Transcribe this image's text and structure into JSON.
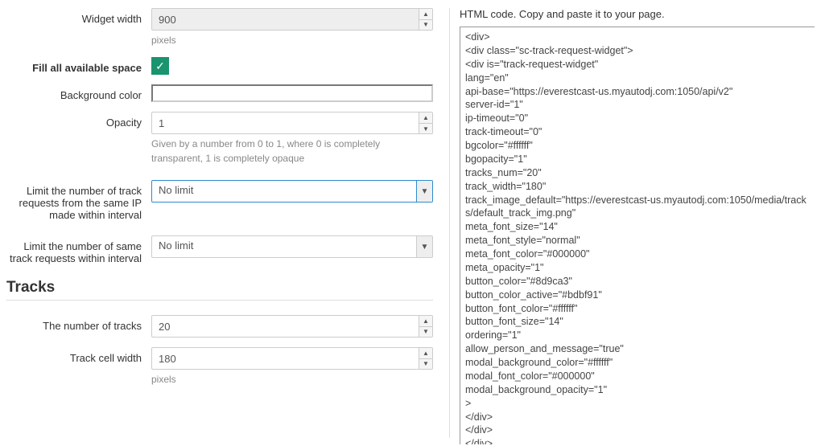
{
  "form": {
    "widget_width": {
      "label": "Widget width",
      "value": "900",
      "help": "pixels"
    },
    "fill_space": {
      "label": "Fill all available space",
      "checked": true
    },
    "background_color": {
      "label": "Background color",
      "value": ""
    },
    "opacity": {
      "label": "Opacity",
      "value": "1",
      "help": "Given by a number from 0 to 1, where 0 is completely transparent, 1 is completely opaque"
    },
    "limit_ip": {
      "label": "Limit the number of track requests from the same IP made within interval",
      "value": "No limit"
    },
    "limit_same_track": {
      "label": "Limit the number of same track requests within interval",
      "value": "No limit"
    },
    "tracks_section": "Tracks",
    "num_tracks": {
      "label": "The number of tracks",
      "value": "20"
    },
    "track_cell_width": {
      "label": "Track cell width",
      "value": "180",
      "help": "pixels"
    }
  },
  "code_panel": {
    "description": "HTML code. Copy and paste it to your page.",
    "code": "<div>\n<div class=\"sc-track-request-widget\">\n<div is=\"track-request-widget\"\nlang=\"en\"\napi-base=\"https://everestcast-us.myautodj.com:1050/api/v2\"\nserver-id=\"1\"\nip-timeout=\"0\"\ntrack-timeout=\"0\"\nbgcolor=\"#ffffff\"\nbgopacity=\"1\"\ntracks_num=\"20\"\ntrack_width=\"180\"\ntrack_image_default=\"https://everestcast-us.myautodj.com:1050/media/tracks/default_track_img.png\"\nmeta_font_size=\"14\"\nmeta_font_style=\"normal\"\nmeta_font_color=\"#000000\"\nmeta_opacity=\"1\"\nbutton_color=\"#8d9ca3\"\nbutton_color_active=\"#bdbf91\"\nbutton_font_color=\"#ffffff\"\nbutton_font_size=\"14\"\nordering=\"1\"\nallow_person_and_message=\"true\"\nmodal_background_color=\"#ffffff\"\nmodal_font_color=\"#000000\"\nmodal_background_opacity=\"1\"\n>\n</div>\n</div>\n</div>"
  }
}
